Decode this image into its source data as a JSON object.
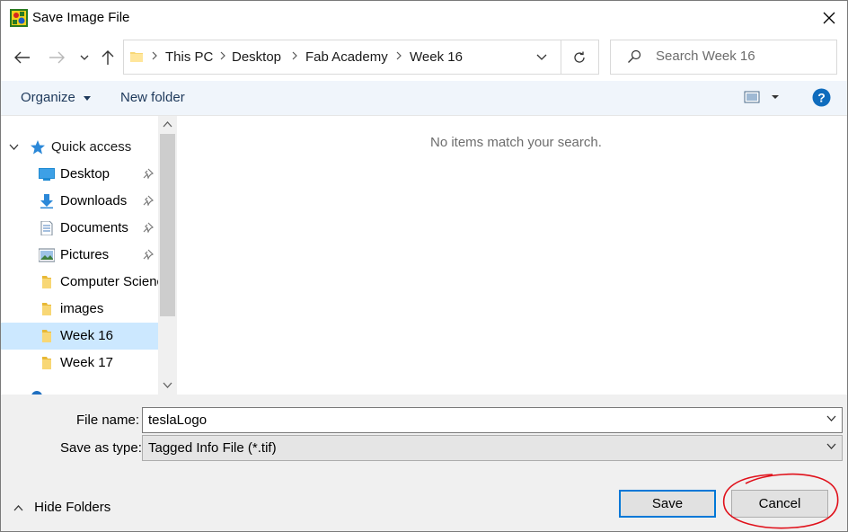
{
  "window": {
    "title": "Save Image File"
  },
  "nav": {
    "breadcrumbs": [
      "This PC",
      "Desktop",
      "Fab Academy",
      "Week 16"
    ],
    "search_placeholder": "Search Week 16"
  },
  "toolbar": {
    "organize_label": "Organize",
    "new_folder_label": "New folder"
  },
  "sidebar": {
    "items": [
      {
        "label": "Quick access",
        "icon": "star-icon"
      },
      {
        "label": "Desktop",
        "icon": "desktop-icon",
        "pinned": true
      },
      {
        "label": "Downloads",
        "icon": "download-icon",
        "pinned": true
      },
      {
        "label": "Documents",
        "icon": "documents-icon",
        "pinned": true
      },
      {
        "label": "Pictures",
        "icon": "pictures-icon",
        "pinned": true
      },
      {
        "label": "Computer Science",
        "icon": "folder-icon"
      },
      {
        "label": "images",
        "icon": "folder-icon"
      },
      {
        "label": "Week 16",
        "icon": "folder-icon",
        "selected": true
      },
      {
        "label": "Week 17",
        "icon": "folder-icon"
      }
    ]
  },
  "main": {
    "empty_message": "No items match your search."
  },
  "form": {
    "file_name_label": "File name:",
    "file_name_value": "teslaLogo",
    "save_type_label": "Save as type:",
    "save_type_value": "Tagged Info File (*.tif)"
  },
  "footer": {
    "hide_folders_label": "Hide Folders",
    "save_label": "Save",
    "cancel_label": "Cancel"
  },
  "colors": {
    "accent": "#0078d7",
    "selection": "#cce8ff",
    "annotation": "#e0101a"
  }
}
